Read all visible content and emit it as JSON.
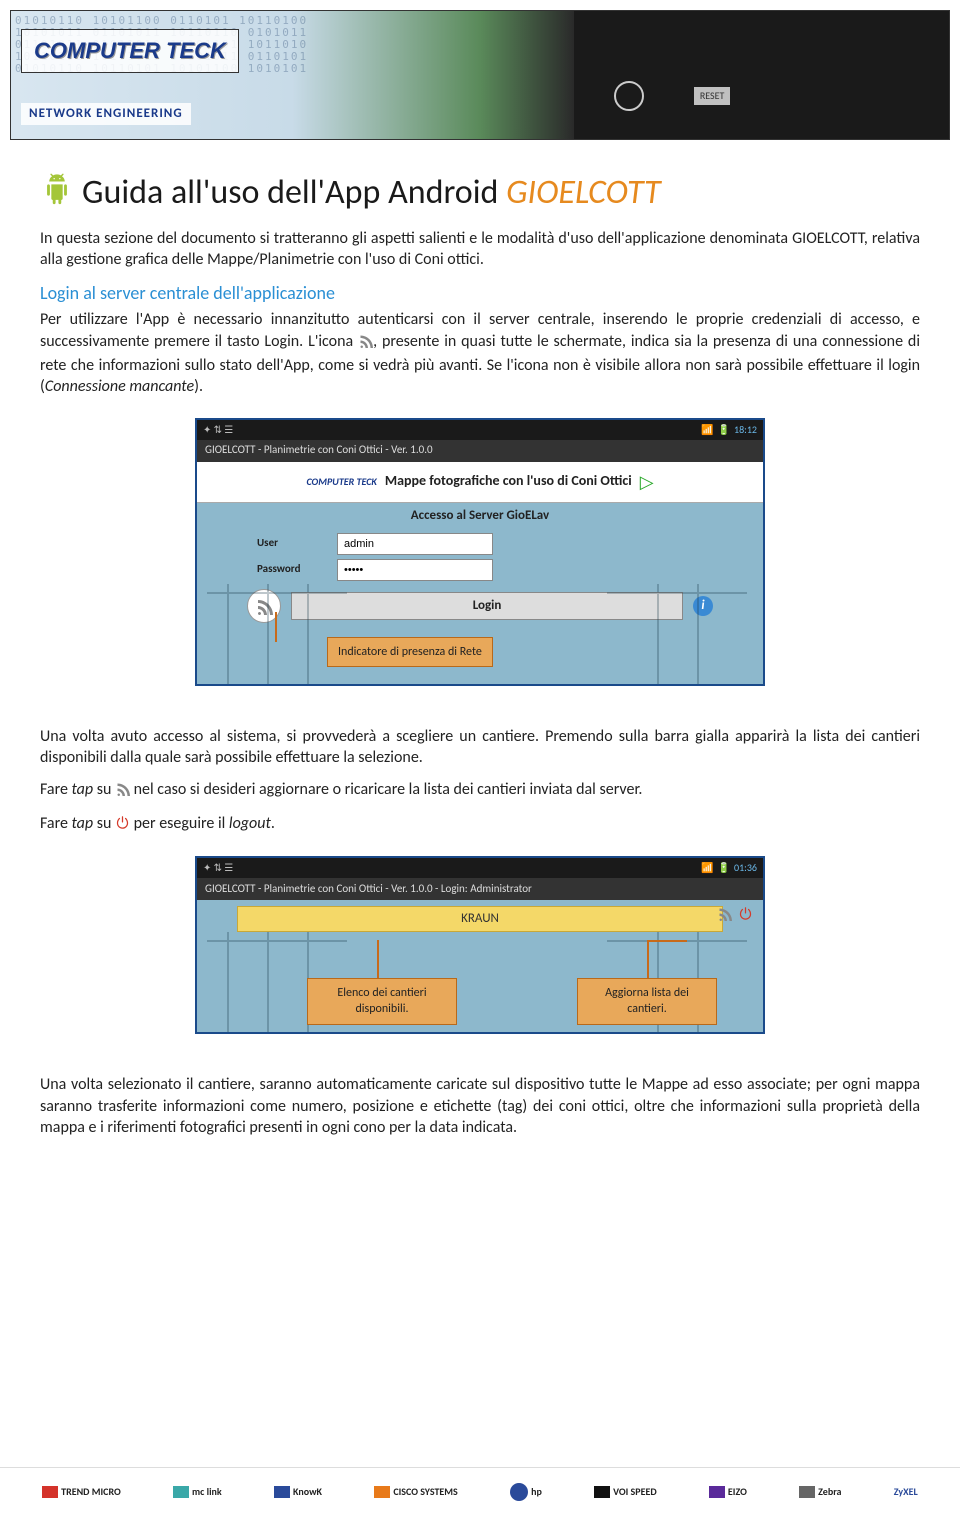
{
  "banner": {
    "logo_top": "COMPUTER TECK",
    "logo_sub": "NETWORK ENGINEERING"
  },
  "title": {
    "prefix": "Guida all'uso dell'App Android ",
    "highlight": "GIOELCOTT"
  },
  "intro": "In questa sezione del documento si tratteranno gli aspetti salienti e le modalità d'uso dell'applicazione denominata GIOELCOTT, relativa alla gestione grafica delle Mappe/Planimetrie con l'uso di Coni ottici.",
  "section1_heading": "Login al server centrale dell'applicazione",
  "section1_p_a": "Per utilizzare l'App è necessario innanzitutto autenticarsi con il server centrale, inserendo le proprie credenziali di accesso, e successivamente premere il tasto Login. L'icona ",
  "section1_p_b": ", presente in quasi tutte le schermate, indica sia la presenza di una connessione di rete che informazioni sullo stato dell'App, come si vedrà più avanti. Se l'icona non è visibile allora non sarà possibile effettuare il login (",
  "section1_p_c": "Connessione mancante",
  "section1_p_d": ").",
  "screenshot1": {
    "status_time": "18:12",
    "app_title": "GIOELCOTT - Planimetrie con Coni Ottici - Ver. 1.0.0",
    "header_brand": "COMPUTER TECK",
    "header_text": "Mappe fotografiche con l'uso di Coni Ottici",
    "header_arrow": "▷",
    "sub_header": "Accesso al Server GioELav",
    "user_label": "User",
    "user_value": "admin",
    "password_label": "Password",
    "password_value": "•••••",
    "login_btn": "Login",
    "callout": "Indicatore di presenza di Rete"
  },
  "para2": "Una volta avuto accesso al sistema, si provvederà a scegliere un cantiere. Premendo sulla barra gialla apparirà la lista dei cantieri disponibili dalla quale sarà possibile effettuare la selezione.",
  "para3_a": "Fare ",
  "para3_tap": "tap",
  "para3_b": " su ",
  "para3_c": " nel caso si desideri aggiornare o ricaricare la lista dei cantieri inviata dal server.",
  "para4_a": "Fare ",
  "para4_b": " su ",
  "para4_c": " per eseguire il ",
  "para4_logout": "logout",
  "para4_d": ".",
  "screenshot2": {
    "status_time": "01:36",
    "app_title": "GIOELCOTT - Planimetrie con Coni Ottici - Ver. 1.0.0 - Login: Administrator",
    "bar_text": "KRAUN",
    "callout_left": "Elenco dei cantieri disponibili.",
    "callout_right": "Aggiorna lista dei cantieri."
  },
  "para5": "Una volta selezionato il cantiere, saranno automaticamente caricate sul dispositivo tutte le Mappe ad esso associate; per ogni mappa saranno trasferite informazioni come numero, posizione e etichette (tag) dei coni ottici, oltre che informazioni sulla proprietà della mappa e i riferimenti fotografici presenti in ogni cono per la data indicata.",
  "footer": {
    "l1": "TREND MICRO",
    "l2": "mc link",
    "l3": "KnowK",
    "l4": "CISCO SYSTEMS",
    "l5": "hp",
    "l6": "VOI SPEED",
    "l7": "EIZO",
    "l8": "Zebra",
    "l9": "ZyXEL"
  }
}
